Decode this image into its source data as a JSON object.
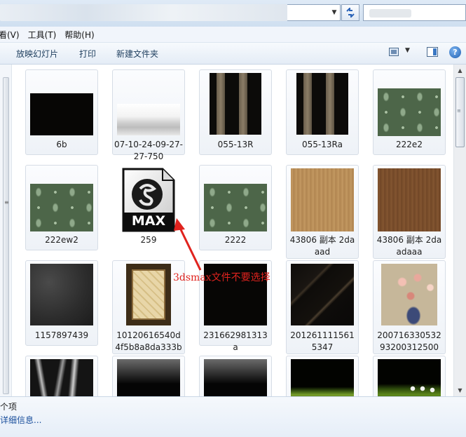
{
  "menu": {
    "view_partial": "看(V)",
    "tools": "工具(T)",
    "help": "帮助(H)"
  },
  "commands": {
    "slideshow": "放映幻灯片",
    "print": "打印",
    "new_folder": "新建文件夹"
  },
  "files": [
    {
      "name": "6b",
      "texture": "solid-black"
    },
    {
      "name": "07-10-24-09-27-27-750",
      "texture": "fog"
    },
    {
      "name": "055-13R",
      "texture": "stripes"
    },
    {
      "name": "055-13Ra",
      "texture": "stripes"
    },
    {
      "name": "222e2",
      "texture": "damask-green"
    },
    {
      "name": "222ew2",
      "texture": "damask-green"
    },
    {
      "name": "259",
      "texture": "3dsmax-file-icon",
      "icon_text": "MAX"
    },
    {
      "name": "2222",
      "texture": "damask-green"
    },
    {
      "name": "43806 副本 2daaad",
      "texture": "tan-wood"
    },
    {
      "name": "43806 副本 2daadaaa",
      "texture": "brown-wood"
    },
    {
      "name": "1157897439",
      "texture": "dark-concrete"
    },
    {
      "name": "10120616540d4f5b8a8da333b5",
      "texture": "rug"
    },
    {
      "name": "231662981313a",
      "texture": "solid-black"
    },
    {
      "name": "20126111156153 47",
      "texture": "black-marble"
    },
    {
      "name": "20071633053293200312500",
      "texture": "flowers"
    },
    {
      "name": "",
      "texture": "shards"
    },
    {
      "name": "",
      "texture": "drips"
    },
    {
      "name": "",
      "texture": "drips"
    },
    {
      "name": "",
      "texture": "green-dark"
    },
    {
      "name": "",
      "texture": "green-white"
    }
  ],
  "labels": {
    "f0": "6b",
    "f1": "07-10-24-09-27-27-750",
    "f2": "055-13R",
    "f3": "055-13Ra",
    "f4": "222e2",
    "f5": "222ew2",
    "f6": "259",
    "f7": "2222",
    "f8": "43806 副本 2daaad",
    "f9": "43806 副本 2daadaaa",
    "f10": "1157897439",
    "f11": "10120616540d4f5b8a8da333b5",
    "f12": "231662981313a",
    "f13": "2012611115615347",
    "f14": "20071633053293200312500"
  },
  "annotation": {
    "text": "3dsmax文件不要选择",
    "color": "#e0231e"
  },
  "details": {
    "count": "个项",
    "link": "详细信息..."
  },
  "icons": {
    "refresh": "refresh-icon",
    "help": "help-icon",
    "views": "views-icon",
    "preview_pane": "preview-pane-icon"
  }
}
